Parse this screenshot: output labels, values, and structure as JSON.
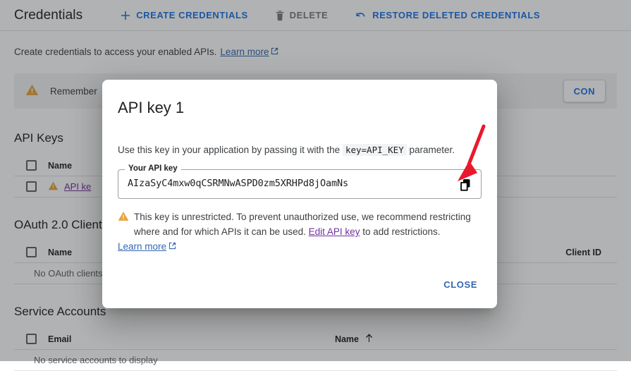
{
  "toolbar": {
    "title": "Credentials",
    "buttons": [
      {
        "label": "CREATE CREDENTIALS",
        "icon": "plus-icon",
        "state": "enabled"
      },
      {
        "label": "DELETE",
        "icon": "trash-icon",
        "state": "disabled"
      },
      {
        "label": "RESTORE DELETED CREDENTIALS",
        "icon": "undo-icon",
        "state": "enabled"
      }
    ]
  },
  "subtitle": {
    "text": "Create credentials to access your enabled APIs.",
    "link_label": "Learn more",
    "link_icon": "external-link-icon"
  },
  "notice": {
    "icon": "warning-triangle-icon",
    "text": "Remember",
    "button_label": "CON"
  },
  "sections": {
    "api_keys": {
      "heading": "API Keys",
      "columns": [
        "Name"
      ],
      "rows": [
        {
          "icon": "warning-triangle-icon",
          "name": "API ke"
        }
      ]
    },
    "oauth": {
      "heading": "OAuth 2.0 Client",
      "columns": [
        "Name",
        "Client ID"
      ],
      "empty_text": "No OAuth clients to"
    },
    "service_accounts": {
      "heading": "Service Accounts",
      "columns": [
        "Email",
        "Name"
      ],
      "sort_icon": "arrow-up-icon",
      "empty_text": "No service accounts to display"
    }
  },
  "dialog": {
    "title": "API key 1",
    "description_before": "Use this key in your application by passing it with the",
    "description_code": "key=API_KEY",
    "description_after": "parameter.",
    "field_label": "Your API key",
    "api_key": "AIzaSyC4mxw0qCSRMNwASPD0zm5XRHPd8jOamNs",
    "copy_icon": "copy-icon",
    "warning_icon": "warning-triangle-icon",
    "warning_text_1": "This key is unrestricted. To prevent unauthorized use, we recommend restricting where and for which APIs it can be used.",
    "warning_link_edit": "Edit API key",
    "warning_text_2": "to add restrictions.",
    "warning_link_learn": "Learn more",
    "warning_link_icon": "external-link-icon",
    "close_label": "CLOSE"
  },
  "annotation": {
    "type": "red-arrow",
    "color": "#e8192c",
    "points_to": "copy-icon"
  },
  "colors": {
    "link_blue": "#1a73e8",
    "link_visited_purple": "#70309e",
    "warning_amber": "#e8a33d",
    "text_primary": "#202124",
    "text_secondary": "#3c4043",
    "scrim": "rgba(32,33,36,0.35)"
  }
}
